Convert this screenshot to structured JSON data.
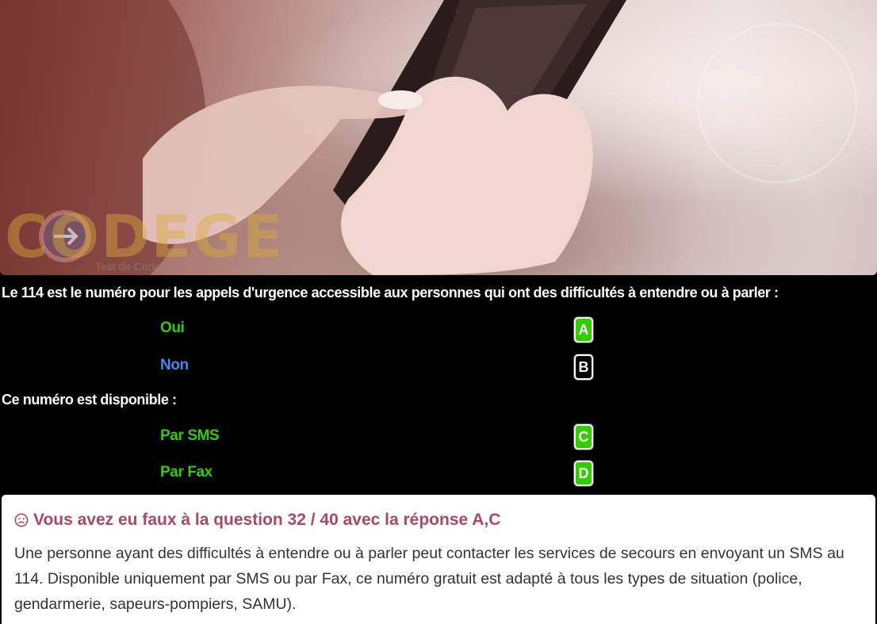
{
  "hero": {
    "watermark": "CODEGE",
    "watermark_sub": "Test de Code de la"
  },
  "questions": [
    {
      "text": "Le 114 est le numéro pour les appels d'urgence accessible aux personnes qui ont des difficultés à entendre ou à parler :",
      "answers": [
        {
          "label": "Oui",
          "letter": "A",
          "label_color": "#33cc00",
          "selected": true
        },
        {
          "label": "Non",
          "letter": "B",
          "label_color": "#4a86e8",
          "selected": false
        }
      ]
    },
    {
      "text": "Ce numéro est disponible :",
      "answers": [
        {
          "label": "Par SMS",
          "letter": "C",
          "label_color": "#33cc00",
          "selected": true
        },
        {
          "label": "Par Fax",
          "letter": "D",
          "label_color": "#33cc00",
          "selected": true
        }
      ]
    }
  ],
  "feedback": {
    "icon": "sad-face-icon",
    "title": "Vous avez eu faux à la question 32 / 40 avec la réponse A,C",
    "explanation": "Une personne ayant des difficultés à entendre ou à parler peut contacter les services de secours en envoyant un SMS au 114. Disponible uniquement par SMS ou par Fax, ce numéro gratuit est adapté à tous les types de situation (police, gendarmerie, sapeurs-pompiers, SAMU).",
    "title_color": "#a94a64"
  },
  "colors": {
    "correct_green": "#33cc00",
    "wrong_blue": "#4a86e8",
    "background": "#000000"
  }
}
